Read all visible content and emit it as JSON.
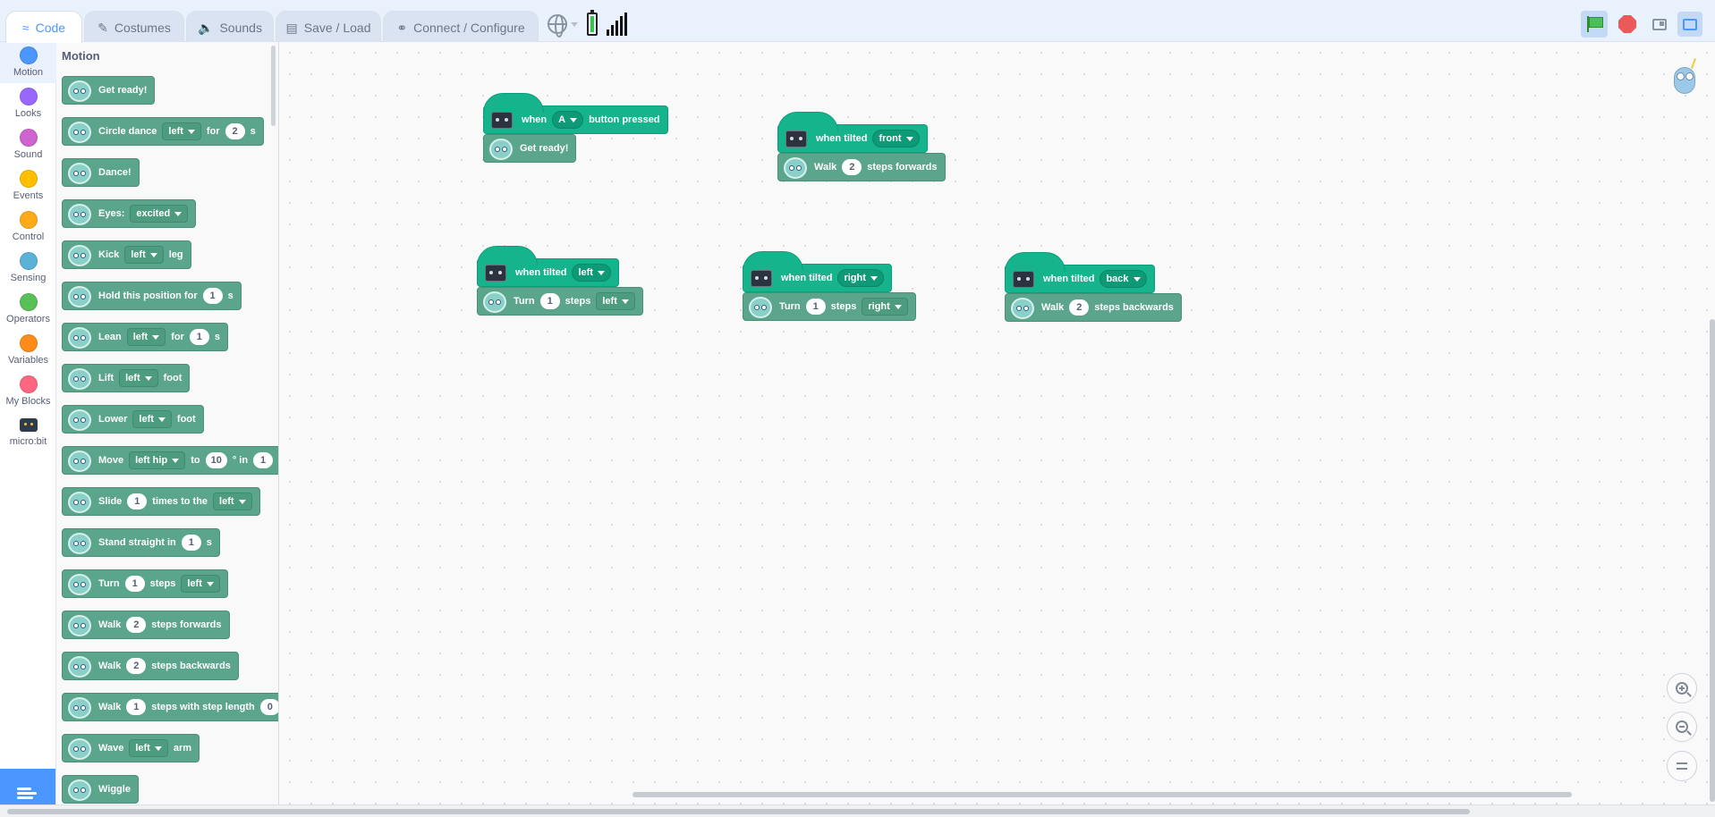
{
  "tabs": [
    {
      "label": "Code",
      "icon": "code-icon"
    },
    {
      "label": "Costumes",
      "icon": "brush-icon"
    },
    {
      "label": "Sounds",
      "icon": "speaker-icon"
    },
    {
      "label": "Save / Load",
      "icon": "floppy-icon"
    },
    {
      "label": "Connect / Configure",
      "icon": "link-icon"
    }
  ],
  "categories": [
    {
      "label": "Motion",
      "color": "#4c97ff"
    },
    {
      "label": "Looks",
      "color": "#9966ff"
    },
    {
      "label": "Sound",
      "color": "#cf63cf"
    },
    {
      "label": "Events",
      "color": "#ffbf00"
    },
    {
      "label": "Control",
      "color": "#ffab19"
    },
    {
      "label": "Sensing",
      "color": "#5cb1d6"
    },
    {
      "label": "Operators",
      "color": "#59c059"
    },
    {
      "label": "Variables",
      "color": "#ff8c1a"
    },
    {
      "label": "My Blocks",
      "color": "#ff6680"
    },
    {
      "label": "micro:bit",
      "icon": "microbit-icon"
    }
  ],
  "flyout": {
    "title": "Motion",
    "blocks": {
      "get_ready": "Get ready!",
      "circle_dance": {
        "a": "Circle dance",
        "dd": "left",
        "b": "for",
        "n": "2",
        "c": "s"
      },
      "dance": "Dance!",
      "eyes": {
        "a": "Eyes:",
        "dd": "excited"
      },
      "kick": {
        "a": "Kick",
        "dd": "left",
        "b": "leg"
      },
      "hold": {
        "a": "Hold this position for",
        "n": "1",
        "b": "s"
      },
      "lean": {
        "a": "Lean",
        "dd": "left",
        "b": "for",
        "n": "1",
        "c": "s"
      },
      "lift": {
        "a": "Lift",
        "dd": "left",
        "b": "foot"
      },
      "lower": {
        "a": "Lower",
        "dd": "left",
        "b": "foot"
      },
      "move": {
        "a": "Move",
        "dd": "left hip",
        "b": "to",
        "n": "10",
        "c": "° in",
        "n2": "1"
      },
      "slide": {
        "a": "Slide",
        "n": "1",
        "b": "times to the",
        "dd": "left"
      },
      "stand": {
        "a": "Stand straight in",
        "n": "1",
        "b": "s"
      },
      "turn": {
        "a": "Turn",
        "n": "1",
        "b": "steps",
        "dd": "left"
      },
      "walk_fwd": {
        "a": "Walk",
        "n": "2",
        "b": "steps forwards"
      },
      "walk_back": {
        "a": "Walk",
        "n": "2",
        "b": "steps backwards"
      },
      "walk_len": {
        "a": "Walk",
        "n": "1",
        "b": "steps with step length",
        "n2": "0"
      },
      "wave": {
        "a": "Wave",
        "dd": "left",
        "b": "arm"
      },
      "wiggle": "Wiggle"
    }
  },
  "scripts": {
    "s1": {
      "when": "when",
      "dd": "A",
      "rest": "button pressed",
      "body": "Get ready!"
    },
    "s2": {
      "when": "when tilted",
      "dd": "front",
      "a": "Walk",
      "n": "2",
      "b": "steps forwards"
    },
    "s3": {
      "when": "when tilted",
      "dd": "left",
      "a": "Turn",
      "n": "1",
      "b": "steps",
      "bdd": "left"
    },
    "s4": {
      "when": "when tilted",
      "dd": "right",
      "a": "Turn",
      "n": "1",
      "b": "steps",
      "bdd": "right"
    },
    "s5": {
      "when": "when tilted",
      "dd": "back",
      "a": "Walk",
      "n": "2",
      "b": "steps backwards"
    }
  },
  "colors": {
    "accent": "#4c97ff",
    "motion_block": "#5ba58c",
    "hat_block": "#16b48c"
  }
}
